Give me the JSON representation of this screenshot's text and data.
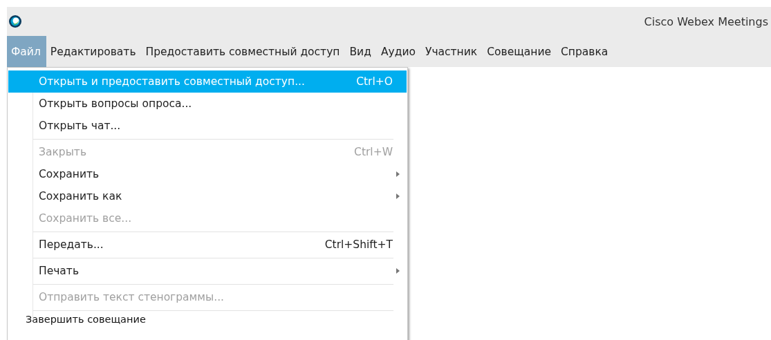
{
  "window": {
    "title": "Cisco Webex Meetings"
  },
  "menu_bar": [
    {
      "label": "Файл",
      "selected": true
    },
    {
      "label": "Редактировать",
      "selected": false
    },
    {
      "label": "Предоставить совместный доступ",
      "selected": false
    },
    {
      "label": "Вид",
      "selected": false
    },
    {
      "label": "Аудио",
      "selected": false
    },
    {
      "label": "Участник",
      "selected": false
    },
    {
      "label": "Совещание",
      "selected": false
    },
    {
      "label": "Справка",
      "selected": false
    }
  ],
  "file_menu": [
    {
      "kind": "item",
      "label": "Открыть и предоставить совместный доступ...",
      "shortcut": "Ctrl+O",
      "selected": true,
      "disabled": false,
      "submenu": false
    },
    {
      "kind": "item",
      "label": "Открыть вопросы опроса...",
      "selected": false,
      "disabled": false,
      "submenu": false
    },
    {
      "kind": "item",
      "label": "Открыть чат...",
      "selected": false,
      "disabled": false,
      "submenu": false
    },
    {
      "kind": "separator"
    },
    {
      "kind": "item",
      "label": "Закрыть",
      "shortcut": "Ctrl+W",
      "selected": false,
      "disabled": true,
      "submenu": false
    },
    {
      "kind": "item",
      "label": "Сохранить",
      "selected": false,
      "disabled": false,
      "submenu": true
    },
    {
      "kind": "item",
      "label": "Сохранить как",
      "selected": false,
      "disabled": false,
      "submenu": true
    },
    {
      "kind": "item",
      "label": "Сохранить все...",
      "selected": false,
      "disabled": true,
      "submenu": false
    },
    {
      "kind": "separator"
    },
    {
      "kind": "item",
      "label": "Передать...",
      "shortcut": "Ctrl+Shift+T",
      "selected": false,
      "disabled": false,
      "submenu": false
    },
    {
      "kind": "separator"
    },
    {
      "kind": "item",
      "label": "Печать",
      "selected": false,
      "disabled": false,
      "submenu": true
    },
    {
      "kind": "separator"
    },
    {
      "kind": "item",
      "label": "Отправить текст стенограммы...",
      "selected": false,
      "disabled": true,
      "submenu": false
    },
    {
      "kind": "separator"
    },
    {
      "kind": "plain",
      "label": "Завершить совещание"
    }
  ]
}
